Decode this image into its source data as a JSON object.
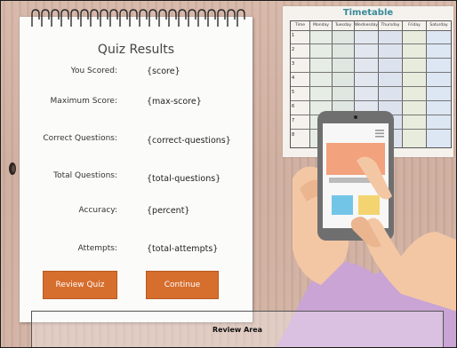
{
  "timetable": {
    "title": "Timetable",
    "days": [
      "Time",
      "Monday",
      "Tuesday",
      "Wednesday",
      "Thursday",
      "Friday",
      "Saturday"
    ],
    "rows": [
      "1",
      "2",
      "3",
      "4",
      "5",
      "6",
      "7",
      "8"
    ]
  },
  "quiz": {
    "title": "Quiz Results",
    "rows": [
      {
        "label": "You Scored:",
        "value": "{score}"
      },
      {
        "label": "Maximum Score:",
        "value": "{max-score}"
      },
      {
        "label": "Correct Questions:",
        "value": "{correct-questions}"
      },
      {
        "label": "Total Questions:",
        "value": "{total-questions}"
      },
      {
        "label": "Accuracy:",
        "value": "{percent}"
      },
      {
        "label": "Attempts:",
        "value": "{total-attempts}"
      }
    ],
    "review_button": "Review Quiz",
    "continue_button": "Continue"
  },
  "review_area": {
    "label": "Review Area"
  },
  "colors": {
    "button": "#d66e2e",
    "timetable_title": "#3a8a9a"
  }
}
